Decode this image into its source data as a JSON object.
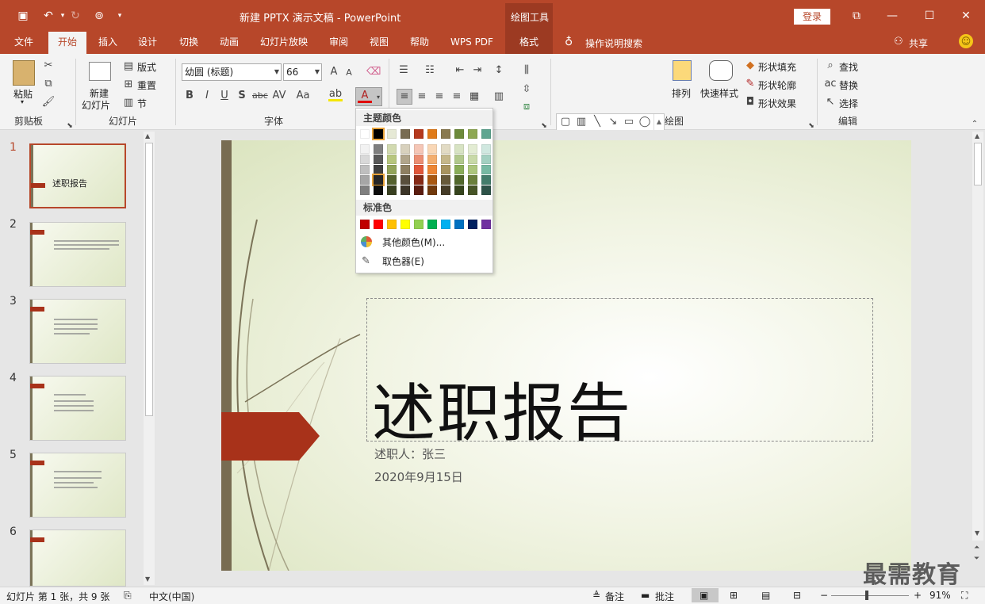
{
  "window": {
    "title": "新建 PPTX 演示文稿 - PowerPoint",
    "context_tab_group": "绘图工具",
    "login_label": "登录",
    "share_label": "共享"
  },
  "tabs": [
    "文件",
    "开始",
    "插入",
    "设计",
    "切换",
    "动画",
    "幻灯片放映",
    "审阅",
    "视图",
    "帮助",
    "WPS PDF",
    "格式"
  ],
  "active_tab": "开始",
  "search_placeholder": "操作说明搜索",
  "ribbon": {
    "clipboard": {
      "paste": "粘贴",
      "label": "剪贴板"
    },
    "slides": {
      "new_slide": "新建\n幻灯片",
      "new_slide_l1": "新建",
      "new_slide_l2": "幻灯片",
      "layout": "版式",
      "reset": "重置",
      "section": "节",
      "label": "幻灯片"
    },
    "font": {
      "font_name": "幼圆 (标题)",
      "font_size": "66",
      "label": "字体"
    },
    "paragraph": {
      "label": ""
    },
    "drawing": {
      "arrange": "排列",
      "quick_styles": "快速样式",
      "shape_fill": "形状填充",
      "shape_outline": "形状轮廓",
      "shape_effects": "形状效果",
      "label": "绘图"
    },
    "editing": {
      "find": "查找",
      "replace": "替换",
      "select": "选择",
      "label": "编辑"
    }
  },
  "color_popup": {
    "theme_header": "主题颜色",
    "standard_header": "标准色",
    "more_colors": "其他颜色(M)...",
    "eyedropper": "取色器(E)",
    "theme_top": [
      "#ffffff",
      "#000000",
      "#e6e9d5",
      "#786c52",
      "#b5391e",
      "#e07b1a",
      "#8a7a50",
      "#6d8a3b",
      "#8ea853",
      "#5ea590"
    ],
    "theme_shades": [
      [
        "#f2f2f2",
        "#7f7f7f",
        "#d2dab0",
        "#d8d1bd",
        "#f5c6b6",
        "#f9d7b6",
        "#e2dbc4",
        "#d7e3c3",
        "#e3ecd3",
        "#d0e8e0"
      ],
      [
        "#d9d9d9",
        "#595959",
        "#b7c67e",
        "#b1a58b",
        "#eb8e73",
        "#f3ae6f",
        "#c5b78a",
        "#b1c88c",
        "#c8d9a8",
        "#a3d0c1"
      ],
      [
        "#bfbfbf",
        "#3f3f3f",
        "#92a35a",
        "#8e7f61",
        "#e0573a",
        "#ec8635",
        "#a8945f",
        "#8aad58",
        "#acc57c",
        "#77b9a3"
      ],
      [
        "#a6a6a6",
        "#262626",
        "#55612f",
        "#594f3c",
        "#872a16",
        "#a85812",
        "#675a3a",
        "#51672b",
        "#6a7f3b",
        "#437c6b"
      ],
      [
        "#7f7f7f",
        "#0d0d0d",
        "#394021",
        "#3c3528",
        "#5a1c0f",
        "#70390c",
        "#453c27",
        "#36441d",
        "#475527",
        "#2d5248"
      ]
    ],
    "standard": [
      "#c00000",
      "#ff0000",
      "#ffc000",
      "#ffff00",
      "#92d050",
      "#00b050",
      "#00b0f0",
      "#0070c0",
      "#002060",
      "#7030a0"
    ]
  },
  "slides": [
    {
      "num": "1",
      "title": "述职报告"
    },
    {
      "num": "2",
      "title": ""
    },
    {
      "num": "3",
      "title": ""
    },
    {
      "num": "4",
      "title": ""
    },
    {
      "num": "5",
      "title": ""
    },
    {
      "num": "6",
      "title": ""
    }
  ],
  "slide": {
    "title": "述职报告",
    "subtitle": "述职人：张三",
    "date": "2020年9月15日"
  },
  "status": {
    "slide_info": "幻灯片 第 1 张，共 9 张",
    "language": "中文(中国)",
    "notes": "备注",
    "comments": "批注",
    "zoom": "91%"
  },
  "watermark": "最需教育"
}
